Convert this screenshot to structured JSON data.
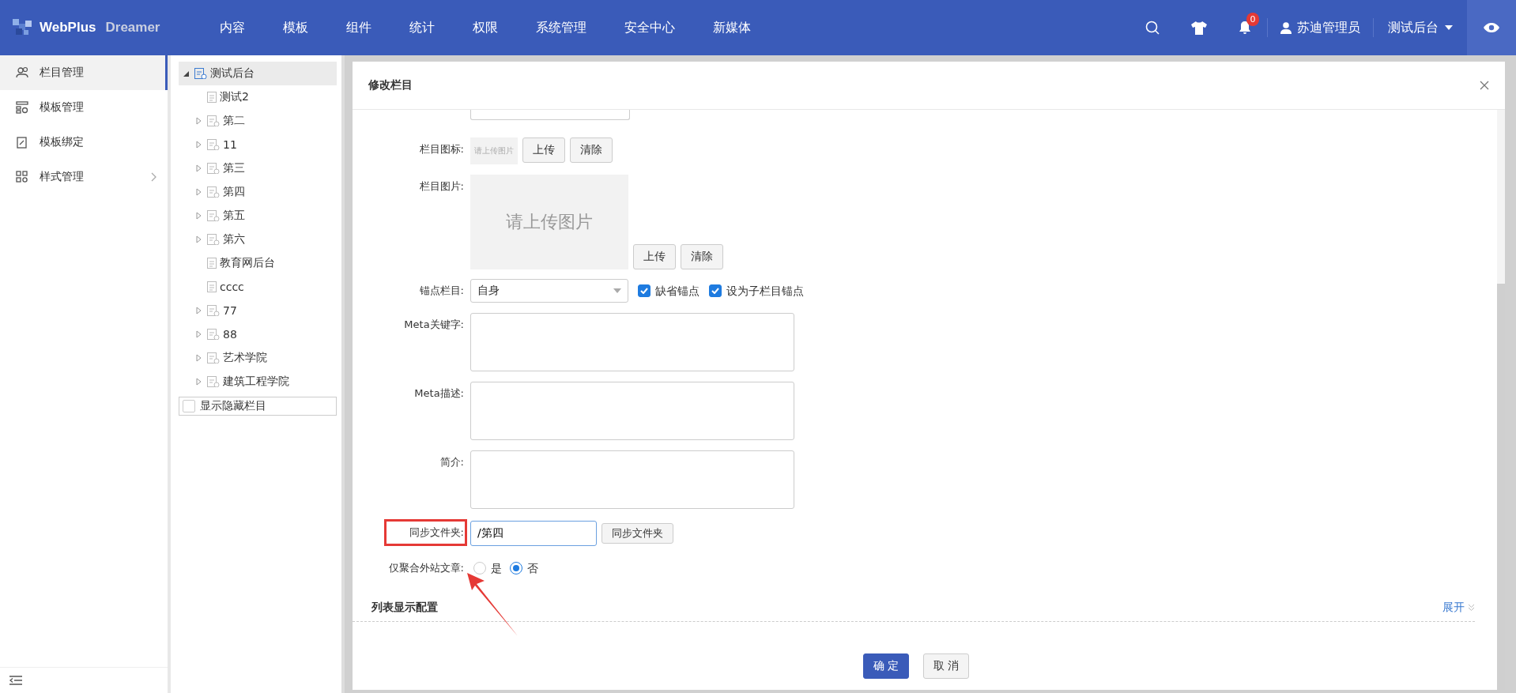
{
  "header": {
    "brand": "WebPlus",
    "product": "Dreamer",
    "nav": [
      {
        "label": "内容"
      },
      {
        "label": "模板"
      },
      {
        "label": "组件"
      },
      {
        "label": "统计"
      },
      {
        "label": "权限"
      },
      {
        "label": "系统管理"
      },
      {
        "label": "安全中心"
      },
      {
        "label": "新媒体"
      }
    ],
    "notification_count": "0",
    "user": "苏迪管理员",
    "site": "测试后台"
  },
  "sidebar": {
    "items": [
      {
        "label": "栏目管理",
        "selected": true,
        "has_submenu": false
      },
      {
        "label": "模板管理",
        "selected": false,
        "has_submenu": false
      },
      {
        "label": "模板绑定",
        "selected": false,
        "has_submenu": false
      },
      {
        "label": "样式管理",
        "selected": false,
        "has_submenu": true
      }
    ]
  },
  "tree": {
    "root": {
      "label": "测试后台",
      "selected": true,
      "expanded": true,
      "children": [
        {
          "label": "测试2",
          "kind": "leaf"
        },
        {
          "label": "第二",
          "kind": "folder"
        },
        {
          "label": "11",
          "kind": "folder"
        },
        {
          "label": "第三",
          "kind": "folder"
        },
        {
          "label": "第四",
          "kind": "folder"
        },
        {
          "label": "第五",
          "kind": "folder"
        },
        {
          "label": "第六",
          "kind": "folder"
        },
        {
          "label": "教育网后台",
          "kind": "leaf"
        },
        {
          "label": "cccc",
          "kind": "leaf"
        },
        {
          "label": "77",
          "kind": "folder"
        },
        {
          "label": "88",
          "kind": "folder"
        },
        {
          "label": "艺术学院",
          "kind": "folder"
        },
        {
          "label": "建筑工程学院",
          "kind": "folder"
        }
      ]
    },
    "show_hidden": {
      "label": "显示隐藏栏目",
      "checked": false
    }
  },
  "dialog": {
    "title": "修改栏目",
    "rows": [
      {
        "kind": "icon_upload",
        "label": "栏目图标:",
        "placeholder": "请上传图片",
        "buttons": [
          "上传",
          "清除"
        ]
      },
      {
        "kind": "image_upload",
        "label": "栏目图片:",
        "placeholder": "请上传图片",
        "buttons": [
          "上传",
          "清除"
        ]
      },
      {
        "kind": "anchor",
        "label": "锚点栏目:",
        "value": "自身",
        "checkboxes": [
          {
            "label": "缺省锚点",
            "checked": true
          },
          {
            "label": "设为子栏目锚点",
            "checked": true
          }
        ]
      },
      {
        "kind": "textarea",
        "label": "Meta关键字:"
      },
      {
        "kind": "textarea",
        "label": "Meta描述:"
      },
      {
        "kind": "textarea",
        "label": "简介:"
      },
      {
        "kind": "sync",
        "label": "同步文件夹:",
        "value": "/第四",
        "buttons": [
          "同步文件夹"
        ],
        "highlighted": true
      },
      {
        "kind": "radio",
        "label": "仅聚合外站文章:",
        "options": [
          {
            "label": "是",
            "selected": false
          },
          {
            "label": "否",
            "selected": true
          }
        ]
      }
    ],
    "section": {
      "title": "列表显示配置",
      "toggle": "展开"
    },
    "buttons": [
      {
        "label": "确 定",
        "primary": true
      },
      {
        "label": "取 消",
        "primary": false
      }
    ]
  }
}
